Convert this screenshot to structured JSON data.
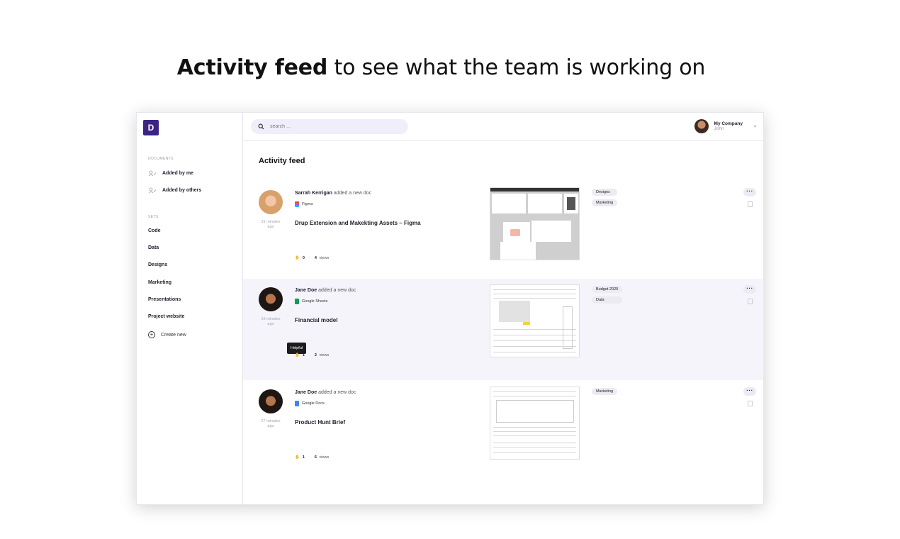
{
  "headline": {
    "bold": "Activity feed",
    "rest": " to see what the team is working on"
  },
  "logo": "D",
  "sidebar": {
    "documents_label": "DOCUMENTS",
    "added_by_me": "Added by me",
    "added_by_others": "Added by others",
    "sets_label": "SETS",
    "sets": [
      "Code",
      "Data",
      "Designs",
      "Marketing",
      "Presentations",
      "Project website"
    ],
    "create_new": "Create new"
  },
  "search": {
    "placeholder": "search ..."
  },
  "account": {
    "company": "My Company",
    "user": "John"
  },
  "feed": {
    "title": "Activity feed",
    "items": [
      {
        "author": "Sarrah Kerrigan",
        "action": "added a new doc",
        "source": "Figma",
        "source_color": "#a259ff",
        "title": "Drup Extension and Makekting Assets – Figma",
        "ago_1": "31 minutes",
        "ago_2": "ago",
        "helpful": "0",
        "views": "4",
        "views_label": "views",
        "tags": [
          "Designs",
          "Marketing"
        ]
      },
      {
        "author": "Jane Doe",
        "action": "added a new doc",
        "source": "Google Sheets",
        "source_color": "#0f9d58",
        "title": "Financial model",
        "ago_1": "16 minutes",
        "ago_2": "ago",
        "helpful": "1",
        "views": "2",
        "views_label": "views",
        "tags": [
          "Budget 2020",
          "Data"
        ],
        "tooltip": "Helpful"
      },
      {
        "author": "Jane Doe",
        "action": "added a new doc",
        "source": "Google Docs",
        "source_color": "#4285f4",
        "title": "Product Hunt Brief",
        "ago_1": "27 minutes",
        "ago_2": "ago",
        "helpful": "1",
        "views": "6",
        "views_label": "views",
        "tags": [
          "Marketing"
        ]
      }
    ]
  },
  "icons": {
    "search": "search-icon",
    "more": "more-icon",
    "trash": "trash-icon",
    "hand": "hand-icon"
  }
}
